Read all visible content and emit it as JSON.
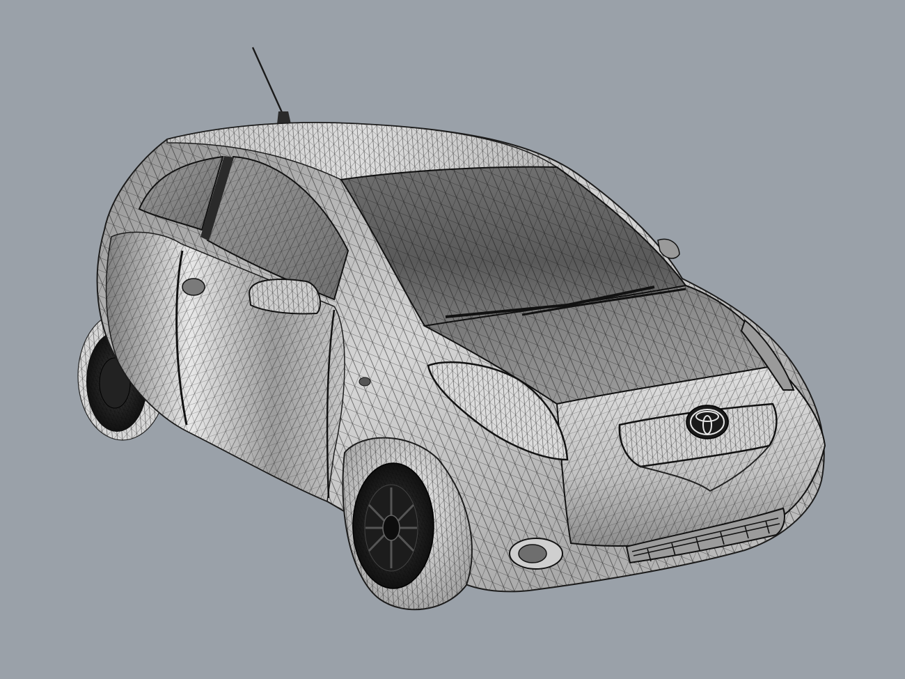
{
  "viewport": {
    "background_color": "#9aa1a9",
    "subject": "car-wireframe",
    "render_mode": "wireframe-shaded"
  },
  "palette": {
    "body_light": "#f2f2f2",
    "body_mid": "#b4b4b4",
    "body_dark": "#6a6a6a",
    "glass": "#5a5a5a",
    "tire": "#141414",
    "wire": "#151515"
  },
  "emblem": {
    "icon": "toyota-emblem-icon"
  }
}
